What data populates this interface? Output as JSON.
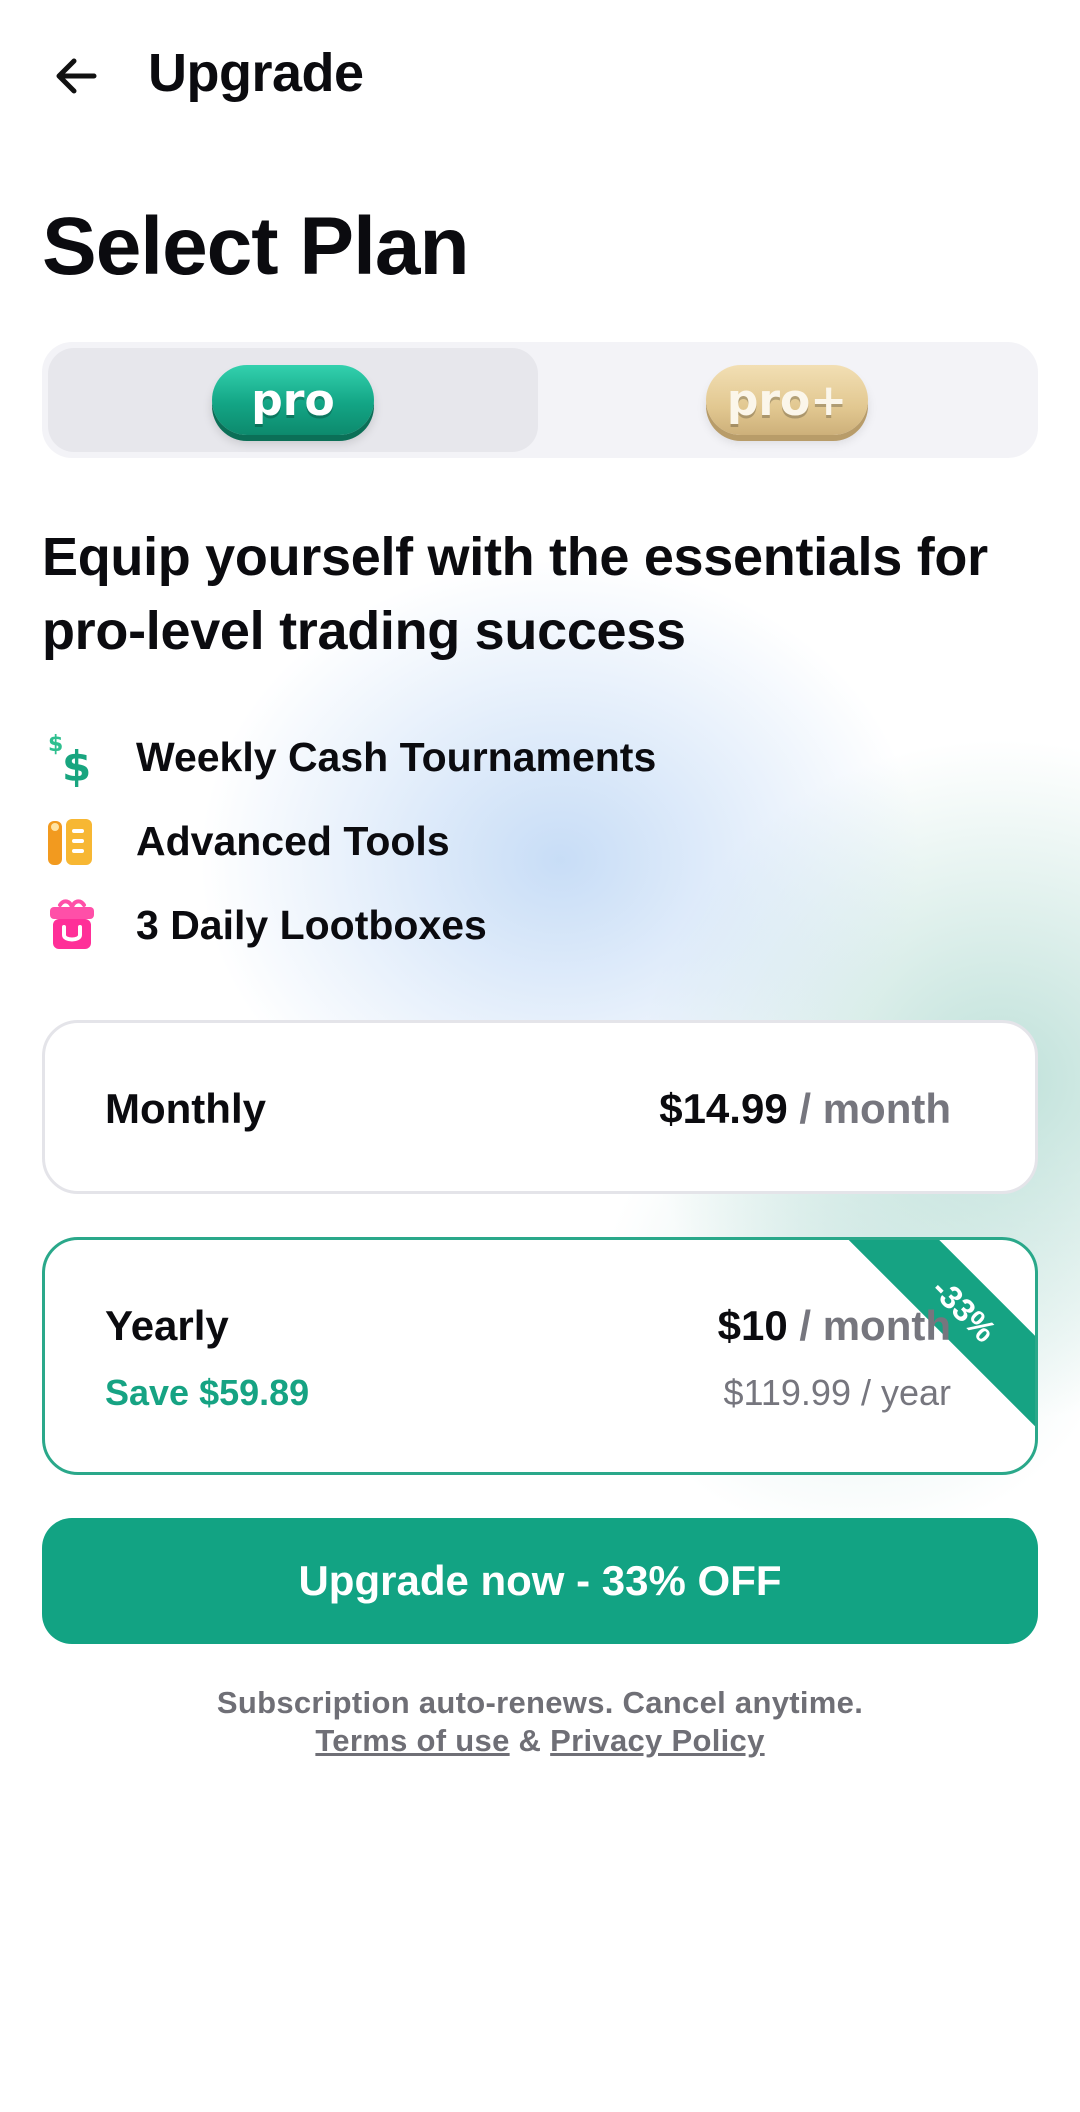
{
  "header": {
    "title": "Upgrade",
    "back_icon": "arrow-left-icon"
  },
  "page_title": "Select Plan",
  "plan_toggle": {
    "options": [
      {
        "label": "pro",
        "selected": true,
        "color": "#13a585"
      },
      {
        "label": "pro+",
        "selected": false,
        "color": "#e2c891"
      }
    ]
  },
  "tagline": "Equip yourself with the essentials for pro-level trading success",
  "features": [
    {
      "icon": "dollar-icon",
      "label": "Weekly Cash Tournaments"
    },
    {
      "icon": "tools-icon",
      "label": "Advanced Tools"
    },
    {
      "icon": "lootbox-icon",
      "label": "3 Daily Lootboxes"
    }
  ],
  "plans": {
    "monthly": {
      "name": "Monthly",
      "price": "$14.99",
      "period": "/ month",
      "selected": false
    },
    "yearly": {
      "name": "Yearly",
      "price": "$10",
      "period": "/ month",
      "savings": "Save $59.89",
      "total": "$119.99 / year",
      "badge": "-33%",
      "selected": true
    }
  },
  "cta": {
    "label": "Upgrade now - 33% OFF"
  },
  "footer": {
    "note": "Subscription auto-renews. Cancel anytime.",
    "terms_link": "Terms of use",
    "separator": "&",
    "privacy_link": "Privacy Policy"
  },
  "colors": {
    "accent": "#12a383",
    "text": "#0b0b0f",
    "muted": "#76767e",
    "gold": "#e2c891"
  }
}
